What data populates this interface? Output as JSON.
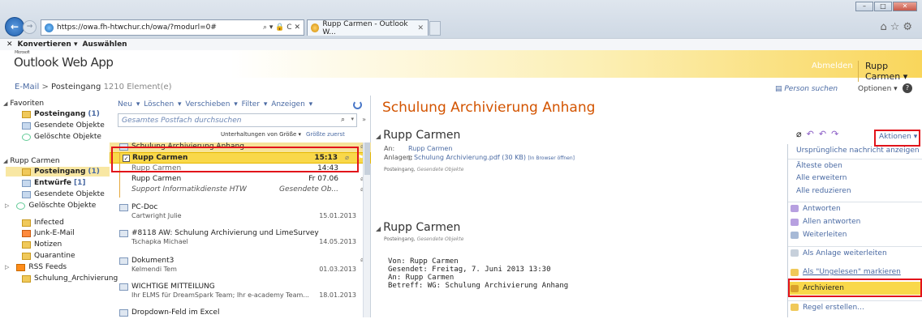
{
  "browser": {
    "url": "https://owa.fh-htwchur.ch/owa/?modurl=0#",
    "tab_title": "Rupp Carmen - Outlook W...",
    "addr_controls": "⌕ ▾ 🔒 C ✕",
    "convert_label": "Konvertieren",
    "select_label": "Auswählen"
  },
  "owa": {
    "brand_small": "Microsoft",
    "app_name": "Outlook Web App",
    "signout": "Abmelden",
    "user": "Rupp Carmen"
  },
  "breadcrumb": {
    "root": "E-Mail",
    "sep": ">",
    "current": "Posteingang",
    "count": "1210 Element(e)"
  },
  "topright": {
    "person_search": "Person suchen",
    "options": "Optionen"
  },
  "sidebar": {
    "favorites_label": "Favoriten",
    "fav_items": [
      {
        "label": "Posteingang",
        "count": "(1)"
      },
      {
        "label": "Gesendete Objekte",
        "count": ""
      },
      {
        "label": "Gelöschte Objekte",
        "count": ""
      }
    ],
    "account_label": "Rupp Carmen",
    "account_items": [
      {
        "label": "Posteingang",
        "count": "(1)"
      },
      {
        "label": "Entwürfe",
        "count": "[1]"
      },
      {
        "label": "Gesendete Objekte",
        "count": ""
      },
      {
        "label": "Gelöschte Objekte",
        "count": ""
      },
      {
        "label": "Infected",
        "count": ""
      },
      {
        "label": "Junk-E-Mail",
        "count": ""
      },
      {
        "label": "Notizen",
        "count": ""
      },
      {
        "label": "Quarantine",
        "count": ""
      },
      {
        "label": "RSS Feeds",
        "count": ""
      },
      {
        "label": "Schulung_Archivierung",
        "count": ""
      }
    ]
  },
  "list": {
    "toolbar": "Neu ▾  Löschen ▾  Verschieben ▾  Filter ▾  Anzeigen ▾",
    "search_placeholder": "Gesamtes Postfach durchsuchen",
    "sort_by": "Unterhaltungen von Größe ▾",
    "sort_order": "Größte zuerst",
    "conversation_subject": "Schulung Archivierung Anhang",
    "messages": [
      {
        "from": "Rupp Carmen",
        "time": "15:13"
      },
      {
        "from": "Rupp Carmen",
        "time": "14:43"
      },
      {
        "from": "Rupp Carmen",
        "time": "Fr 07.06"
      },
      {
        "from": "Support Informatikdienste HTW",
        "time": "Gesendete Ob..."
      }
    ],
    "items": [
      {
        "subject": "PC-Doc",
        "from": "Cartwright Julie",
        "date": "15.01.2013"
      },
      {
        "subject": "#8118 AW: Schulung Archivierung und LimeSurvey",
        "from": "Tschapka Michael",
        "date": "14.05.2013"
      },
      {
        "subject": "Dokument3",
        "from": "Kelmendi Tem",
        "date": "01.03.2013"
      },
      {
        "subject": "WICHTIGE MITTEILUNG",
        "from": "Ihr ELMS für DreamSpark Team; Ihr e-academy Team...",
        "date": "18.01.2013"
      },
      {
        "subject": "Dropdown-Feld im Excel",
        "from": "",
        "date": ""
      }
    ]
  },
  "reading": {
    "title": "Schulung Archivierung Anhang",
    "msg1": {
      "sender": "Rupp Carmen",
      "to_label": "An:",
      "to": "Rupp Carmen",
      "att_label": "Anlagen:",
      "attachment": "Schulung Archivierung.pdf (30 KB)",
      "attachment_link": "[In Browser öffnen]",
      "folder": "Posteingang,",
      "folder2": "Gesendete Objekte"
    },
    "msg2": {
      "sender": "Rupp Carmen",
      "folder": "Posteingang,",
      "folder2": "Gesendete Objekte",
      "body": [
        "Von: Rupp Carmen",
        "Gesendet: Freitag, 7. Juni 2013 13:30",
        "An: Rupp Carmen",
        "Betreff: WG: Schulung Archivierung Anhang"
      ]
    },
    "actions_label": "Aktionen ▾"
  },
  "menu": {
    "items": [
      "Ursprüngliche nachricht anzeigen",
      "Älteste oben",
      "Alle erweitern",
      "Alle reduzieren",
      "Antworten",
      "Allen antworten",
      "Weiterleiten",
      "Als Anlage weiterleiten",
      "Als \"Ungelesen\" markieren",
      "Archivieren",
      "Regel erstellen..."
    ]
  },
  "colors": {
    "accent_orange": "#d35400",
    "link_blue": "#4a6aa3",
    "highlight": "#f9d84a",
    "annotation_red": "#e2131a"
  }
}
